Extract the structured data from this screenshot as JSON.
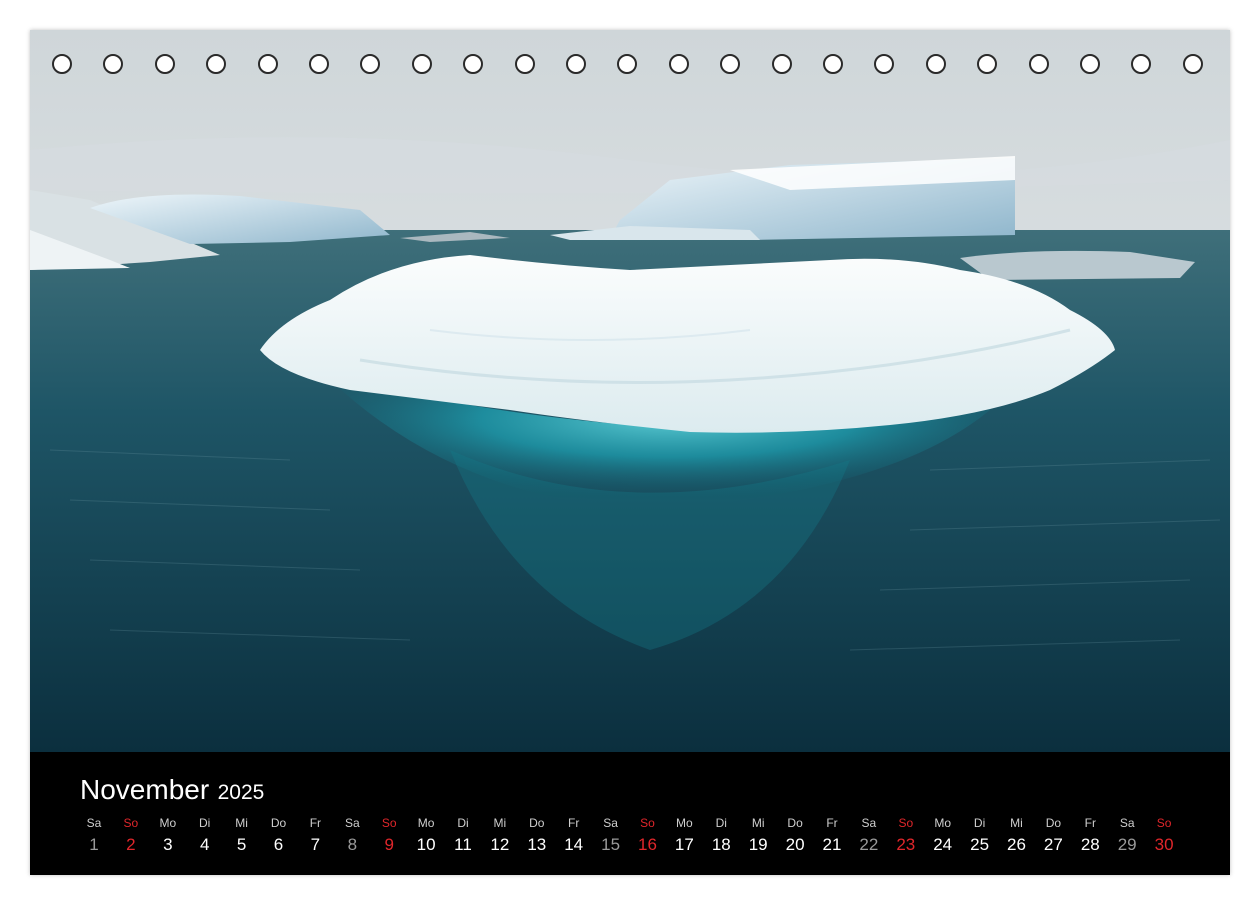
{
  "calendar": {
    "month": "November",
    "year": "2025",
    "days": [
      {
        "weekday": "Sa",
        "day": "1",
        "type": "sat"
      },
      {
        "weekday": "So",
        "day": "2",
        "type": "sun"
      },
      {
        "weekday": "Mo",
        "day": "3",
        "type": "weekday"
      },
      {
        "weekday": "Di",
        "day": "4",
        "type": "weekday"
      },
      {
        "weekday": "Mi",
        "day": "5",
        "type": "weekday"
      },
      {
        "weekday": "Do",
        "day": "6",
        "type": "weekday"
      },
      {
        "weekday": "Fr",
        "day": "7",
        "type": "weekday"
      },
      {
        "weekday": "Sa",
        "day": "8",
        "type": "sat"
      },
      {
        "weekday": "So",
        "day": "9",
        "type": "sun"
      },
      {
        "weekday": "Mo",
        "day": "10",
        "type": "weekday"
      },
      {
        "weekday": "Di",
        "day": "11",
        "type": "weekday"
      },
      {
        "weekday": "Mi",
        "day": "12",
        "type": "weekday"
      },
      {
        "weekday": "Do",
        "day": "13",
        "type": "weekday"
      },
      {
        "weekday": "Fr",
        "day": "14",
        "type": "weekday"
      },
      {
        "weekday": "Sa",
        "day": "15",
        "type": "sat"
      },
      {
        "weekday": "So",
        "day": "16",
        "type": "sun"
      },
      {
        "weekday": "Mo",
        "day": "17",
        "type": "weekday"
      },
      {
        "weekday": "Di",
        "day": "18",
        "type": "weekday"
      },
      {
        "weekday": "Mi",
        "day": "19",
        "type": "weekday"
      },
      {
        "weekday": "Do",
        "day": "20",
        "type": "weekday"
      },
      {
        "weekday": "Fr",
        "day": "21",
        "type": "weekday"
      },
      {
        "weekday": "Sa",
        "day": "22",
        "type": "sat"
      },
      {
        "weekday": "So",
        "day": "23",
        "type": "sun"
      },
      {
        "weekday": "Mo",
        "day": "24",
        "type": "weekday"
      },
      {
        "weekday": "Di",
        "day": "25",
        "type": "weekday"
      },
      {
        "weekday": "Mi",
        "day": "26",
        "type": "weekday"
      },
      {
        "weekday": "Do",
        "day": "27",
        "type": "weekday"
      },
      {
        "weekday": "Fr",
        "day": "28",
        "type": "weekday"
      },
      {
        "weekday": "Sa",
        "day": "29",
        "type": "sat"
      },
      {
        "weekday": "So",
        "day": "30",
        "type": "sun"
      }
    ]
  },
  "binding": {
    "hole_count": 23
  },
  "colors": {
    "sunday": "#e0262b",
    "saturday": "#9a9a9a",
    "weekday": "#ffffff",
    "bar_background": "#000000"
  }
}
